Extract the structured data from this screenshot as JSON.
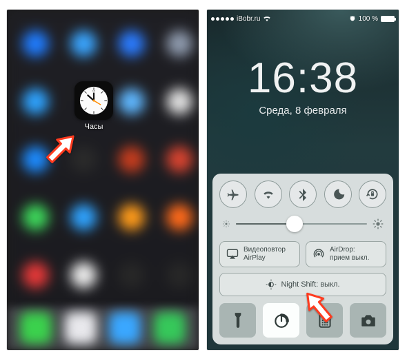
{
  "left": {
    "clock_app_label": "Часы"
  },
  "right": {
    "status": {
      "carrier": "iBobr.ru",
      "battery_pct": "100 %"
    },
    "time": "16:38",
    "date": "Среда, 8 февраля",
    "control_center": {
      "airplay": {
        "line1": "Видеоповтор",
        "line2": "AirPlay"
      },
      "airdrop": {
        "line1": "AirDrop:",
        "line2": "прием выкл."
      },
      "night_shift": "Night Shift: выкл."
    }
  }
}
